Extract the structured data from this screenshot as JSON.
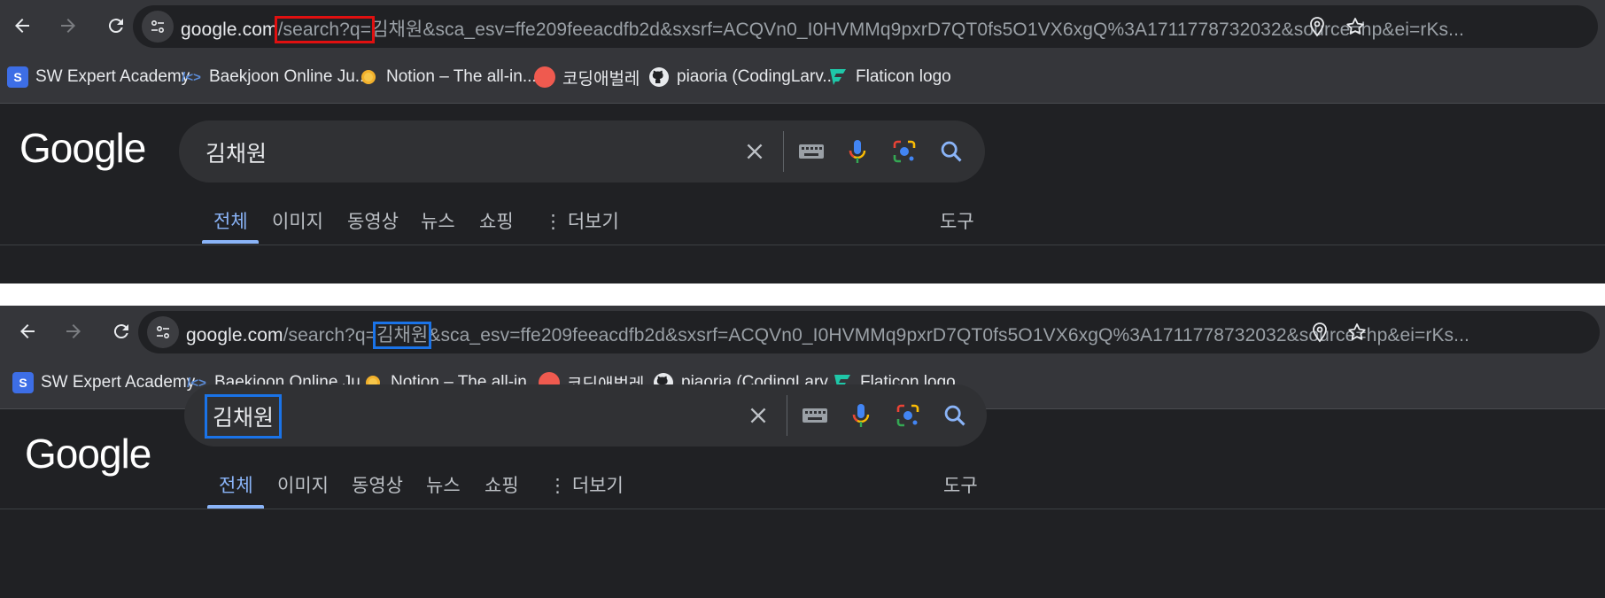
{
  "browser": {
    "url_host": "google.com",
    "url_path_prefix": "/search?q=",
    "url_query_term": "김채원",
    "url_rest": "&sca_esv=ffe209feeacdfb2d&sxsrf=ACQVn0_I0HVMMq9pxrD7QT0fs5O1VX6xgQ%3A1711778732032&source=hp&ei=rKs..."
  },
  "bookmarks": [
    {
      "label": "SW Expert Academy",
      "icon": "swea-icon"
    },
    {
      "label": "Baekjoon Online Ju...",
      "icon": "code-brackets-icon"
    },
    {
      "label": "Notion – The all-in...",
      "icon": "sun-icon"
    },
    {
      "label": "코딩애벌레",
      "icon": "bug-icon"
    },
    {
      "label": "piaoria (CodingLarv...",
      "icon": "github-icon"
    },
    {
      "label": "Flaticon logo",
      "icon": "flaticon-icon"
    }
  ],
  "google": {
    "logo": "Google",
    "query": "김채원",
    "tabs": [
      "전체",
      "이미지",
      "동영상",
      "뉴스",
      "쇼핑",
      "더보기"
    ],
    "tools": "도구"
  },
  "colors": {
    "highlight_red": "#e01010",
    "highlight_blue": "#1a73e8",
    "active_tab": "#8ab4f8"
  }
}
